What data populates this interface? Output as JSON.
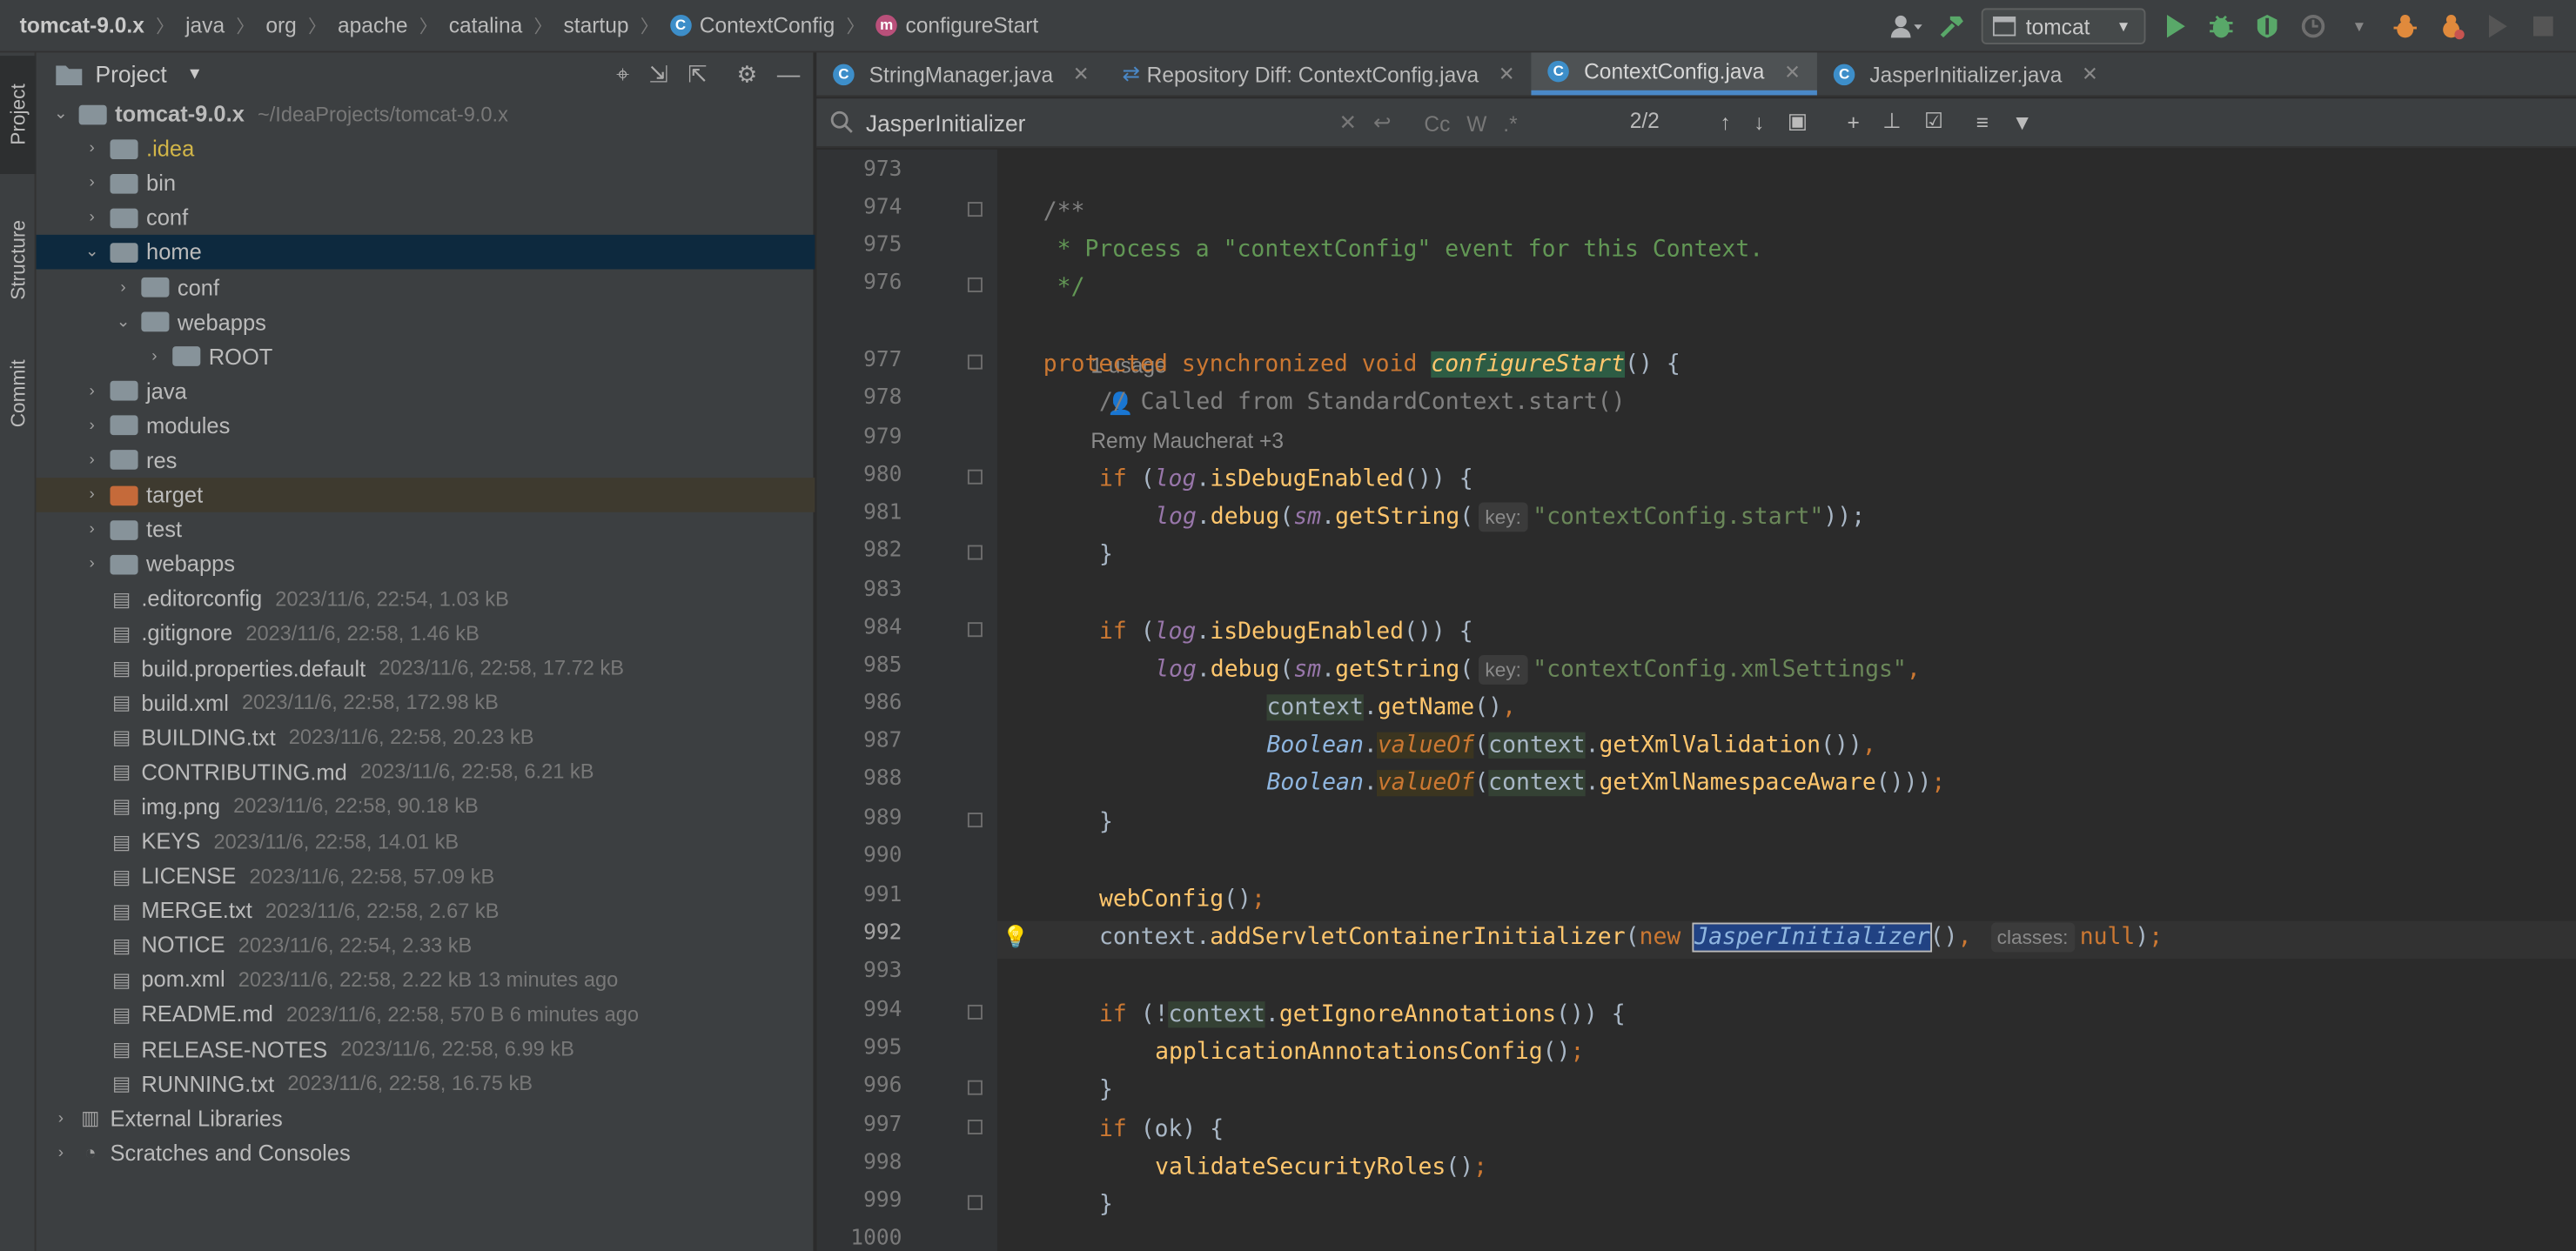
{
  "breadcrumb": [
    "tomcat-9.0.x",
    "java",
    "org",
    "apache",
    "catalina",
    "startup",
    "ContextConfig",
    "configureStart"
  ],
  "run_config": "tomcat",
  "side_tabs": [
    "Project",
    "Structure",
    "Commit"
  ],
  "project_panel": {
    "title": "Project",
    "tree": [
      {
        "name": "tomcat-9.0.x",
        "meta": "~/IdeaProjects/tomcat-9.0.x",
        "level": 0,
        "kind": "folder",
        "open": true
      },
      {
        "name": ".idea",
        "level": 1,
        "kind": "folder",
        "style": "yel"
      },
      {
        "name": "bin",
        "level": 1,
        "kind": "folder"
      },
      {
        "name": "conf",
        "level": 1,
        "kind": "folder"
      },
      {
        "name": "home",
        "level": 1,
        "kind": "folder",
        "open": true,
        "selected": true
      },
      {
        "name": "conf",
        "level": 2,
        "kind": "folder"
      },
      {
        "name": "webapps",
        "level": 2,
        "kind": "folder",
        "open": true
      },
      {
        "name": "ROOT",
        "level": 3,
        "kind": "folder"
      },
      {
        "name": "java",
        "level": 1,
        "kind": "folder"
      },
      {
        "name": "modules",
        "level": 1,
        "kind": "folder"
      },
      {
        "name": "res",
        "level": 1,
        "kind": "folder"
      },
      {
        "name": "target",
        "level": 1,
        "kind": "folder",
        "orange": true,
        "highlight": true
      },
      {
        "name": "test",
        "level": 1,
        "kind": "folder"
      },
      {
        "name": "webapps",
        "level": 1,
        "kind": "folder"
      },
      {
        "name": ".editorconfig",
        "meta": "2023/11/6, 22:54, 1.03 kB",
        "level": 1,
        "kind": "file"
      },
      {
        "name": ".gitignore",
        "meta": "2023/11/6, 22:58, 1.46 kB",
        "level": 1,
        "kind": "file"
      },
      {
        "name": "build.properties.default",
        "meta": "2023/11/6, 22:58, 17.72 kB",
        "level": 1,
        "kind": "file"
      },
      {
        "name": "build.xml",
        "meta": "2023/11/6, 22:58, 172.98 kB",
        "level": 1,
        "kind": "file"
      },
      {
        "name": "BUILDING.txt",
        "meta": "2023/11/6, 22:58, 20.23 kB",
        "level": 1,
        "kind": "file"
      },
      {
        "name": "CONTRIBUTING.md",
        "meta": "2023/11/6, 22:58, 6.21 kB",
        "level": 1,
        "kind": "file"
      },
      {
        "name": "img.png",
        "meta": "2023/11/6, 22:58, 90.18 kB",
        "level": 1,
        "kind": "file"
      },
      {
        "name": "KEYS",
        "meta": "2023/11/6, 22:58, 14.01 kB",
        "level": 1,
        "kind": "file"
      },
      {
        "name": "LICENSE",
        "meta": "2023/11/6, 22:58, 57.09 kB",
        "level": 1,
        "kind": "file"
      },
      {
        "name": "MERGE.txt",
        "meta": "2023/11/6, 22:58, 2.67 kB",
        "level": 1,
        "kind": "file"
      },
      {
        "name": "NOTICE",
        "meta": "2023/11/6, 22:54, 2.33 kB",
        "level": 1,
        "kind": "file"
      },
      {
        "name": "pom.xml",
        "meta": "2023/11/6, 22:58, 2.22 kB 13 minutes ago",
        "level": 1,
        "kind": "file"
      },
      {
        "name": "README.md",
        "meta": "2023/11/6, 22:58, 570 B 6 minutes ago",
        "level": 1,
        "kind": "file"
      },
      {
        "name": "RELEASE-NOTES",
        "meta": "2023/11/6, 22:58, 6.99 kB",
        "level": 1,
        "kind": "file"
      },
      {
        "name": "RUNNING.txt",
        "meta": "2023/11/6, 22:58, 16.75 kB",
        "level": 1,
        "kind": "file"
      },
      {
        "name": "External Libraries",
        "level": 0,
        "kind": "lib"
      },
      {
        "name": "Scratches and Consoles",
        "level": 0,
        "kind": "scratch"
      }
    ]
  },
  "tabs": [
    {
      "label": "StringManager.java",
      "icon": "class-icon"
    },
    {
      "label": "Repository Diff: ContextConfig.java",
      "icon": "diff-icon"
    },
    {
      "label": "ContextConfig.java",
      "icon": "class-icon",
      "active": true
    },
    {
      "label": "JasperInitializer.java",
      "icon": "class-icon"
    }
  ],
  "search": {
    "query": "JasperInitializer",
    "match": "2/2"
  },
  "editor": {
    "line_numbers": [
      "973",
      "974",
      "975",
      "976",
      "977",
      "978",
      "979",
      "980",
      "981",
      "982",
      "983",
      "984",
      "985",
      "986",
      "987",
      "988",
      "989",
      "990",
      "991",
      "992",
      "993",
      "994",
      "995",
      "996",
      "997",
      "998",
      "999",
      "1000"
    ],
    "usage_lens": "1 usage",
    "author_lens": "Remy Maucherat +3",
    "current_line": "992"
  }
}
